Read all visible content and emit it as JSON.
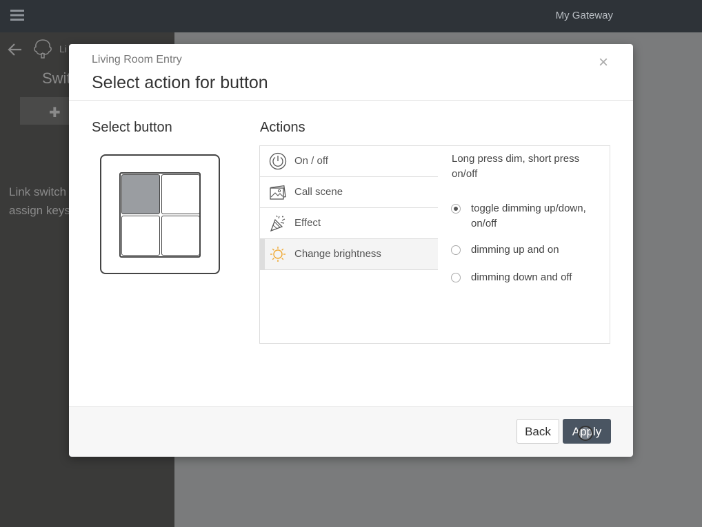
{
  "topbar": {
    "gateway_name": "My Gateway"
  },
  "sidebar": {
    "crumb": "Li",
    "title": "Swit",
    "add_icon": "plus-icon",
    "text_line1": "Link switch",
    "text_line2": "assign keys"
  },
  "modal": {
    "subtitle": "Living Room Entry",
    "title": "Select action for button",
    "close_label": "×",
    "select_button_heading": "Select button",
    "actions_heading": "Actions",
    "keys": [
      {
        "position": "top-left",
        "selected": true
      },
      {
        "position": "top-right",
        "selected": false
      },
      {
        "position": "bottom-left",
        "selected": false
      },
      {
        "position": "bottom-right",
        "selected": false
      }
    ],
    "actions": [
      {
        "label": "On / off",
        "icon": "power-icon",
        "active": false
      },
      {
        "label": "Call scene",
        "icon": "scene-icon",
        "active": false
      },
      {
        "label": "Effect",
        "icon": "party-popper-icon",
        "active": false
      },
      {
        "label": "Change brightness",
        "icon": "sun-icon",
        "active": true
      }
    ],
    "options": {
      "description": "Long press dim, short press on/off",
      "radios": [
        {
          "label": "toggle dimming up/down, on/off",
          "checked": true
        },
        {
          "label": "dimming up and on",
          "checked": false
        },
        {
          "label": "dimming down and off",
          "checked": false
        }
      ]
    },
    "footer": {
      "back_label": "Back",
      "apply_label": "Apply"
    }
  },
  "colors": {
    "topbar": "#2e3338",
    "sidebar": "#3a3a39",
    "overlay": "#7a7b7c",
    "primary_button": "#4a5562",
    "selected_key": "#9a9da1",
    "brightness_icon": "#f0a830"
  }
}
